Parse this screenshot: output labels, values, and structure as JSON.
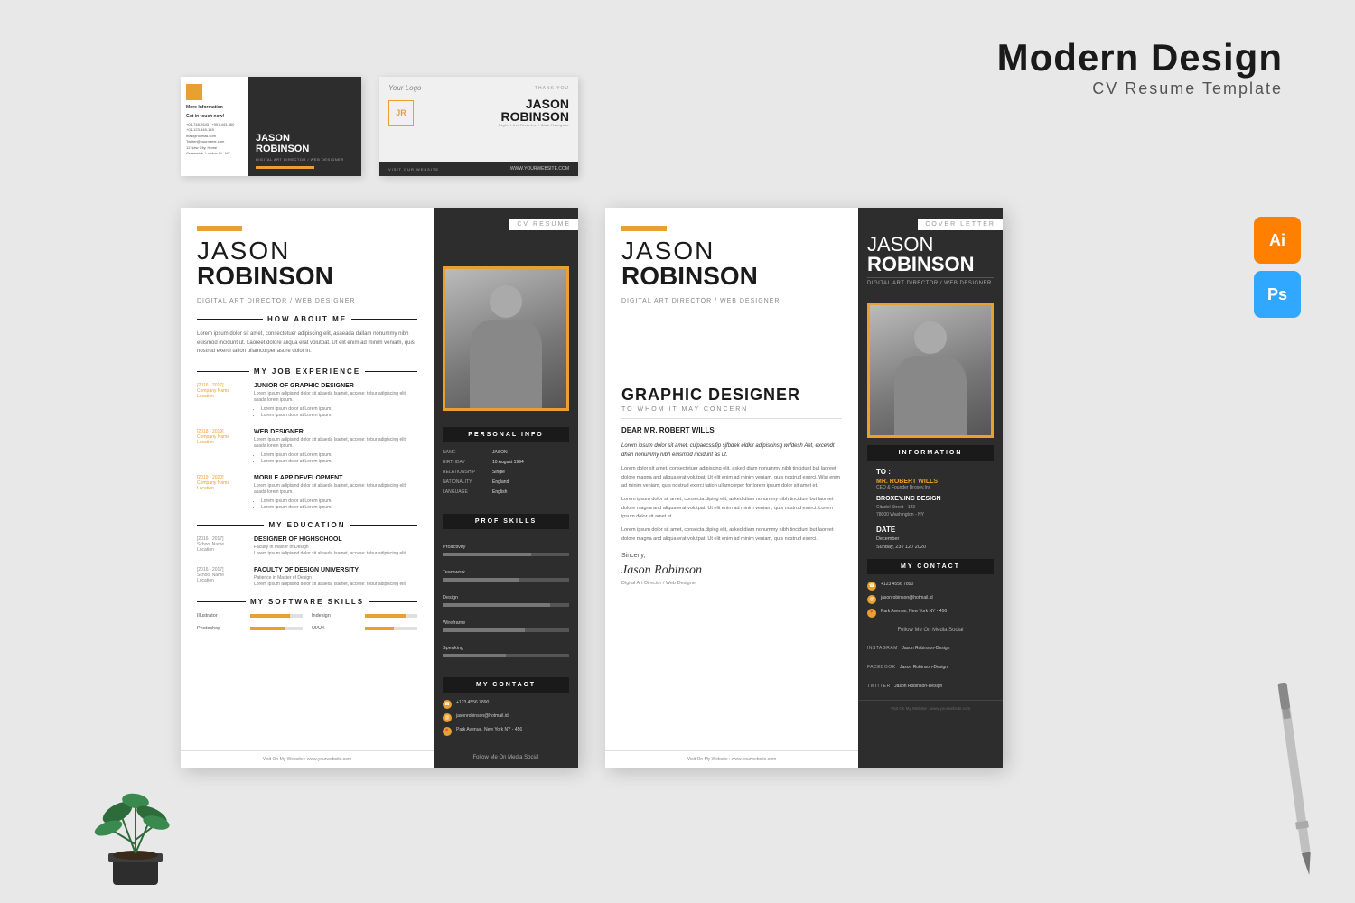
{
  "page": {
    "title": "Modern Design",
    "subtitle": "CV Resume Template",
    "background": "#e8e8e8"
  },
  "tools": {
    "ai_label": "Ai",
    "ps_label": "Ps"
  },
  "person": {
    "first_name": "JASON",
    "last_name": "ROBINSON",
    "role": "Digital Art Director / Web Designer",
    "birthday": "10 August 1994",
    "relationship": "Single",
    "nationality": "England",
    "language": "English",
    "phone": "+123 4556 7890",
    "email": "jasonrobinson@hotmail.id",
    "address": "Park Avenue, New York NY - 456",
    "website": "www.yourwebsite.com"
  },
  "bcard": {
    "card1": {
      "orange_box": "More Information",
      "get_in_touch": "Get in touch now!",
      "name_line1": "JASON",
      "name_line2": "ROBINSON",
      "job_title": "Digital Art Director / Web Designer"
    },
    "card2": {
      "logo": "Your Logo",
      "thank_you": "THANK YOU",
      "initials": "JR",
      "name_line1": "JASON",
      "name_line2": "ROBINSON",
      "job_title": "Digital Art Director / Web Designer",
      "visit": "VISIT OUR WEBSITE",
      "website": "WWW.YOURWEBSITE.COM"
    }
  },
  "cv": {
    "label": "CV RESUME",
    "about_title": "HOW ABOUT ME",
    "about_text": "Lorem ipsum dolor sit amet, consectetuer adipiscing elit, asaeada dallam nonummy nibh euismod incidunt ut. Laoreet dolore aliqua erat volutpat. Ut elit enim ad minim veniam, quis nostrud exerci tation ullamcorper asure dolor in.",
    "experience_title": "MY JOB EXPERIENCE",
    "jobs": [
      {
        "years": "[2016 - 2017]",
        "company": "Company Name",
        "location": "Location",
        "title": "Junior of Graphic Designer",
        "desc": "Lorem ipsum adipismd dolor sit abaeda Isamet, accese: tebur adipiscing elit asada lorem ipsum.",
        "bullets": [
          "Lorem ipsum dolor at Lorem ipsum.",
          "Lorem ipsum dolor at Lorem ipsum."
        ]
      },
      {
        "years": "[2018 - 2019]",
        "company": "Company Name",
        "location": "Location",
        "title": "Web Designer",
        "desc": "Lorem ipsum adipismd dolor sit abaeda Isamet, accese: tebur adipiscing elit asada lorem ipsum.",
        "bullets": [
          "Lorem ipsum dolor at Lorem ipsum.",
          "Lorem ipsum dolor at Lorem ipsum."
        ]
      },
      {
        "years": "[2019 - 2020]",
        "company": "Company Name",
        "location": "Location",
        "title": "Mobile App Development",
        "desc": "Lorem ipsum adipismd dolor sit abaeda Isamet, accese: tebur adipiscing elit asada lorem ipsum.",
        "bullets": [
          "Lorem ipsum dolor at Lorem ipsum.",
          "Lorem ipsum dolor at Lorem ipsum."
        ]
      }
    ],
    "education_title": "MY EDUCATION",
    "education": [
      {
        "years": "[2016 - 2017]",
        "school": "School Name",
        "location": "Location",
        "degree": "Designer of Highschool",
        "field": "Faculty in Master of Design"
      },
      {
        "years": "[2016 - 2017]",
        "school": "School Name",
        "location": "Location",
        "degree": "Faculty of Design University",
        "field": "Patience in Master of Design"
      }
    ],
    "software_title": "MY SOFTWARE SKILLS",
    "software_skills": [
      {
        "name": "Illustrator",
        "percent": 75
      },
      {
        "name": "Photoshop",
        "percent": 65
      },
      {
        "name": "Indesign",
        "percent": 80
      },
      {
        "name": "UI/UX",
        "percent": 55
      }
    ],
    "personal_info_title": "PERSONAL INFO",
    "prof_skills_title": "PROF SKILLS",
    "prof_skills": [
      {
        "name": "Proactivity",
        "percent": 70
      },
      {
        "name": "Teamwork",
        "percent": 60
      },
      {
        "name": "Design",
        "percent": 85
      },
      {
        "name": "Wireframe",
        "percent": 65
      },
      {
        "name": "Speaking",
        "percent": 50
      }
    ],
    "contact_title": "MY CONTACT",
    "social_title": "Follow Me On Media Social",
    "social": [
      {
        "platform": "Instagram",
        "handle": "Jason Robinson-Design"
      },
      {
        "platform": "Facebook",
        "handle": "Jason Robinson-Design"
      },
      {
        "platform": "Twitter",
        "handle": "Jason Robinson-Design"
      }
    ],
    "footer": "Visit On My Website : www.yourwebsite.com"
  },
  "cover": {
    "label": "COVER LETTER",
    "gd_title": "GRAPHIC DESIGNER",
    "gd_sub": "TO WHOM IT MAY CONCERN",
    "dear": "DEAR MR. ROBERT WILLS",
    "body1": "Lorem ipsum dolor sit amet, culpaecssifip sjfbdek eldkir adipiscinsg wrfdesh Aet, excendt dhan nonummy nibh euismod incidunt as ut.",
    "body2": "Lorem dolor sit amet, consectetuer adipiscing elit, asked diam nonummy nibh tincidunt but laoreet dolore magna and aliqua erat volutpat. Ut elit enim ad minim veniam, quis nostrud exerci. Wisi enim ad minim veniam, quis nostrud exerci tation ullamcorper for lorem ipsum dolor sit amet et.",
    "body3": "Lorem ipsum dolor sit amet, consecta.diping elit, asked diam nonummy nibh tincidunt but laoreet dolore magna and aliqua erat volutpat. Ut elit enim ad minim veniam, quis nostrud exerci. Lorem ipsum dolor sit amet et.",
    "body4": "Lorem ipsum dolor sit amet, consecta.diping elit, asked diam nonummy nibh tincidunt but laoreet dolore magna and aliqua erat volutpat. Ut elit enim ad minim veniam, quis nostrud exerci.",
    "sincerely": "Sincerly,",
    "signature": "Jason Robinson",
    "sig_title": "Digital Art Director / Web Designer",
    "info_title": "INFORMATION",
    "to_label": "TO :",
    "to_name": "MR. ROBERT WILLS",
    "to_title": "CEO & Founder Broxey.Inc",
    "company_label": "BROXEY.INC DESIGN",
    "company_address": "Citadel Street - 123\n78000 Washington - NY",
    "date_label": "DATE",
    "date_month": "December",
    "date_full": "Sunday, 23 / 12 / 2020",
    "footer": "Visit On My Website : www.yourwebsite.com"
  }
}
